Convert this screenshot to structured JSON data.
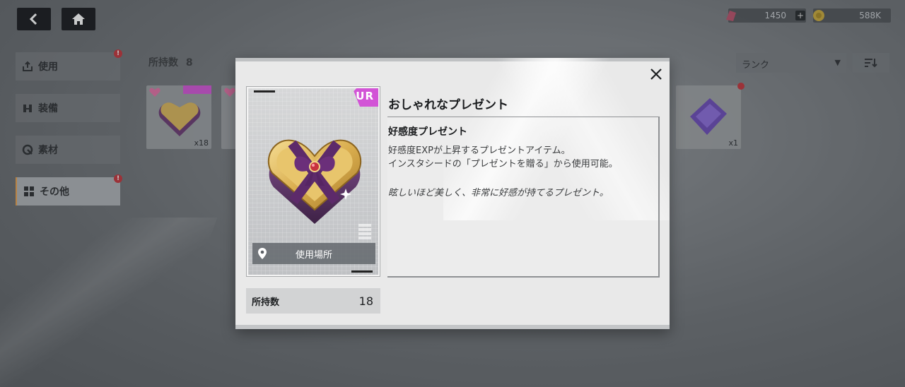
{
  "topbar": {
    "back_icon": "arrow-left-icon",
    "home_icon": "home-icon",
    "gem_amount": "1450",
    "plus_label": "+",
    "coin_amount": "588K"
  },
  "sidebar": {
    "items": [
      {
        "label": "使用",
        "icon": "use-icon",
        "badge": "!"
      },
      {
        "label": "装備",
        "icon": "equipment-icon",
        "badge": ""
      },
      {
        "label": "素材",
        "icon": "material-icon",
        "badge": ""
      },
      {
        "label": "その他",
        "icon": "other-icon",
        "badge": "!"
      }
    ]
  },
  "inventory": {
    "count_label": "所持数",
    "count_value": "8",
    "sort_select": "ランク",
    "cards": [
      {
        "qty": "x18"
      },
      {
        "qty": ""
      },
      {
        "qty": "x1"
      }
    ]
  },
  "modal": {
    "rarity": "UR",
    "item_name": "おしゃれなプレゼント",
    "use_place_label": "使用場所",
    "owned_label": "所持数",
    "owned_value": "18",
    "category": "好感度プレゼント",
    "description_line1": "好感度EXPが上昇するプレゼントアイテム。",
    "description_line2": "インスタシードの「プレゼントを贈る」から使用可能。",
    "flavor_text": "眩しいほど美しく、非常に好感が持てるプレゼント。",
    "colors": {
      "rarity_ur": "#d254d6",
      "accent": "#e9a04b",
      "badge": "#c2343b"
    }
  }
}
